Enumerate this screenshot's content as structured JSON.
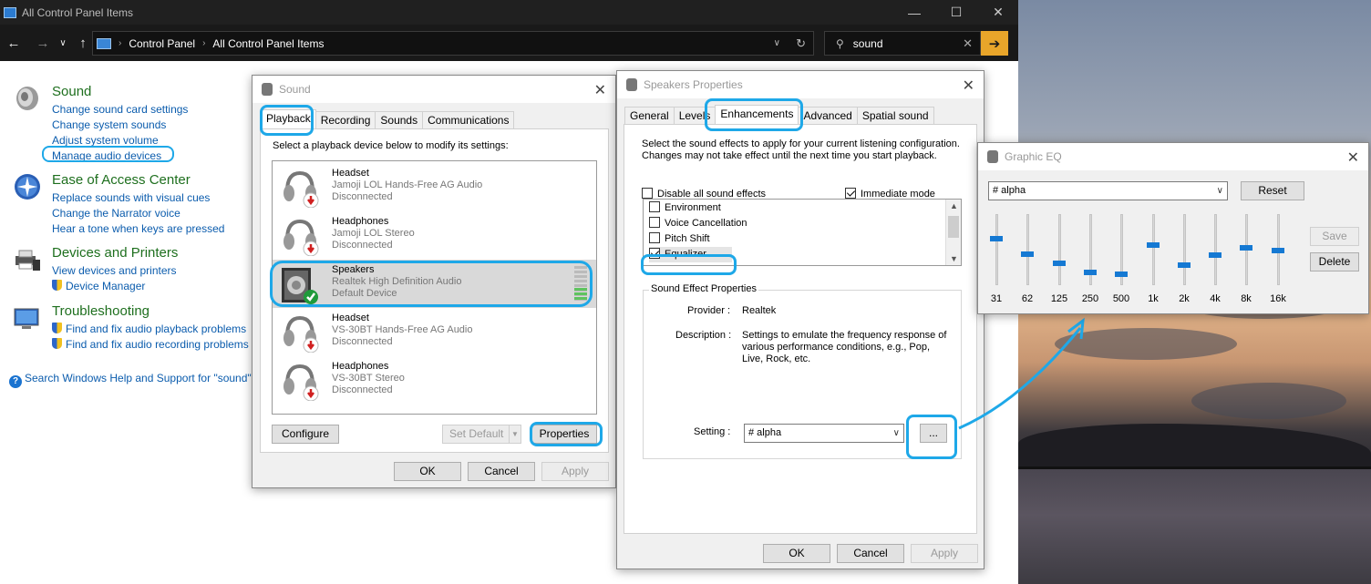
{
  "explorer": {
    "title": "All Control Panel Items",
    "breadcrumb": [
      "Control Panel",
      "All Control Panel Items"
    ],
    "search_value": "sound",
    "sections": [
      {
        "title": "Sound",
        "links": [
          "Change sound card settings",
          "Change system sounds",
          "Adjust system volume",
          "Manage audio devices"
        ]
      },
      {
        "title": "Ease of Access Center",
        "links": [
          "Replace sounds with visual cues",
          "Change the Narrator voice",
          "Hear a tone when keys are pressed"
        ]
      },
      {
        "title": "Devices and Printers",
        "links": [
          "View devices and printers",
          "Device Manager"
        ]
      },
      {
        "title": "Troubleshooting",
        "links": [
          "Find and fix audio playback problems",
          "Find and fix audio recording problems"
        ]
      }
    ],
    "help_link": "Search Windows Help and Support for \"sound\""
  },
  "sound_dialog": {
    "title": "Sound",
    "tabs": [
      "Playback",
      "Recording",
      "Sounds",
      "Communications"
    ],
    "instruction": "Select a playback device below to modify its settings:",
    "devices": [
      {
        "name": "Headset",
        "desc": "Jamoji LOL Hands-Free AG Audio",
        "state": "Disconnected"
      },
      {
        "name": "Headphones",
        "desc": "Jamoji LOL Stereo",
        "state": "Disconnected"
      },
      {
        "name": "Speakers",
        "desc": "Realtek High Definition Audio",
        "state": "Default Device"
      },
      {
        "name": "Headset",
        "desc": "VS-30BT Hands-Free AG Audio",
        "state": "Disconnected"
      },
      {
        "name": "Headphones",
        "desc": "VS-30BT Stereo",
        "state": "Disconnected"
      }
    ],
    "buttons": {
      "configure": "Configure",
      "set_default": "Set Default",
      "properties": "Properties",
      "ok": "OK",
      "cancel": "Cancel",
      "apply": "Apply"
    }
  },
  "speakers_dialog": {
    "title": "Speakers Properties",
    "tabs": [
      "General",
      "Levels",
      "Enhancements",
      "Advanced",
      "Spatial sound"
    ],
    "instruction": "Select the sound effects to apply for your current listening configuration. Changes may not take effect until the next time you start playback.",
    "disable_all": "Disable all sound effects",
    "immediate_mode": "Immediate mode",
    "effects": [
      {
        "label": "Environment",
        "checked": false
      },
      {
        "label": "Voice Cancellation",
        "checked": false
      },
      {
        "label": "Pitch Shift",
        "checked": false
      },
      {
        "label": "Equalizer",
        "checked": true
      }
    ],
    "group_label": "Sound Effect Properties",
    "provider_label": "Provider :",
    "provider_value": "Realtek",
    "description_label": "Description :",
    "description_value": "Settings to emulate the frequency response of various performance conditions,  e.g., Pop, Live, Rock, etc.",
    "setting_label": "Setting :",
    "setting_value": "# alpha",
    "more_button": "...",
    "buttons": {
      "ok": "OK",
      "cancel": "Cancel",
      "apply": "Apply"
    }
  },
  "eq_dialog": {
    "title": "Graphic EQ",
    "preset": "# alpha",
    "reset": "Reset",
    "save": "Save",
    "delete": "Delete",
    "bands": [
      {
        "label": "31",
        "level": 0.67
      },
      {
        "label": "62",
        "level": 0.43
      },
      {
        "label": "125",
        "level": 0.29
      },
      {
        "label": "250",
        "level": 0.15
      },
      {
        "label": "500",
        "level": 0.12
      },
      {
        "label": "1k",
        "level": 0.57
      },
      {
        "label": "2k",
        "level": 0.27
      },
      {
        "label": "4k",
        "level": 0.41
      },
      {
        "label": "8k",
        "level": 0.53
      },
      {
        "label": "16k",
        "level": 0.49
      }
    ]
  },
  "accent_color": "#1ea8e8"
}
